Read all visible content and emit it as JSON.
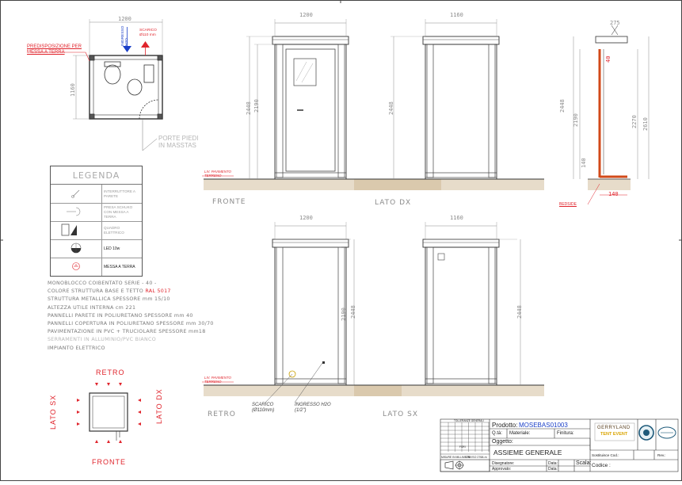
{
  "dims": {
    "plan_w": "1200",
    "plan_h": "1160",
    "fronte_w": "1200",
    "fronte_h1": "2448",
    "fronte_h2": "2190",
    "lato_dx_w": "1160",
    "lato_dx_h": "2448",
    "section_a": "2448",
    "section_b": "2190",
    "section_c": "2270",
    "section_d": "2610",
    "section_e": "140",
    "section_f": "140",
    "section_g": "40",
    "section_top": "275",
    "retro_w": "1200",
    "retro_h1": "2190",
    "retro_h2": "2448",
    "lato_sx_w": "1160",
    "lato_sx_h": "2448"
  },
  "plan_labels": {
    "predisposizione": "PREDISPOSIZIONE PER\nMESSA A TERRA",
    "ingresso": "INGRESSO\nH2O",
    "scarico": "SCARICO\nØ110 mm",
    "piedi": "PORTE PIEDI\nIN MASSTAS"
  },
  "view_labels": {
    "fronte": "FRONTE",
    "lato_dx": "LATO DX",
    "retro": "RETRO",
    "lato_sx": "LATO SX",
    "key_retro": "RETRO",
    "key_lato_sx": "LATO SX",
    "key_lato_dx": "LATO DX",
    "key_fronte": "FRONTE"
  },
  "ground_labels": {
    "fronte": "LIV. PAVIMENTO\nTERRENO",
    "retro": "LIV. PAVIMENTO\nTERRENO",
    "section": "BEDSIDE"
  },
  "retro_callouts": {
    "scarico": "SCARICO\n(Ø110mm)",
    "ingresso": "INGRESSO H2O\n(1/2\")"
  },
  "legend": {
    "title": "LEGENDA",
    "rows": [
      {
        "label": "INTERRUTTORE A PARETE",
        "symbol": "switch-icon",
        "dark": false
      },
      {
        "label": "PRESA SCHUKO CON MESSA A TERRA",
        "symbol": "socket-icon",
        "dark": false
      },
      {
        "label": "QUADRO ELETTRICO",
        "symbol": "panel-icon",
        "dark": false
      },
      {
        "label": "LED 10w",
        "symbol": "led-lamp-icon",
        "dark": true
      },
      {
        "label": "MESSA A TERRA",
        "symbol": "ground-icon",
        "dark": true
      }
    ],
    "panel_small": "QUADRO ELETTRICO"
  },
  "notes": [
    {
      "text": "MONOBLOCCO COIBENTATO SERIE - 40 -",
      "color": "#7a7a7a"
    },
    {
      "text": "COLORE STRUTTURA BASE E TETTO  RAL 5017",
      "color": "#7a7a7a",
      "accent": "RAL 5017"
    },
    {
      "text": "STRUTTURA METALLICA SPESSORE mm 15/10",
      "color": "#7a7a7a"
    },
    {
      "text": "ALTEZZA UTILE INTERNA cm 221",
      "color": "#7a7a7a"
    },
    {
      "text": "PANNELLI PARETE IN POLIURETANO SPESSORE mm 40",
      "color": "#7a7a7a"
    },
    {
      "text": "PANNELLI COPERTURA IN POLIURETANO SPESSORE mm 30/70",
      "color": "#7a7a7a"
    },
    {
      "text": "PAVIMENTAZIONE IN PVC + TRUCIOLARE SPESSORE mm18",
      "color": "#7a7a7a"
    },
    {
      "text": "SERRAMENTI IN ALLUMINIO/PVC BIANCO",
      "color": "#b8b8b8"
    },
    {
      "text": "IMPIANTO ELETTRICO",
      "color": "#7a7a7a"
    }
  ],
  "title_block": {
    "prodotto_label": "Prodotto:",
    "prodotto_value": "MOSEBAS01003",
    "qta_label": "Q.tà:",
    "materiale_label": "Materiale:",
    "finitura_label": "Finitura:",
    "oggetto_label": "Oggetto:",
    "oggetto_value": "ASSIEME GENERALE",
    "disegnatore_label": "Disegnatore:",
    "approvato_label": "Approvato:",
    "data1_label": "Data:",
    "data2_label": "Data:",
    "scala_label": "Scala:",
    "sostituisce_label": "Sostituisce Cod.:",
    "rev_label": "Rev.:",
    "codice_label": "Codice :",
    "brand_name": "GERRYLAND",
    "brand_sub": "TENT EVENT",
    "tolleranze_title": "TOLLERANZE GENERALI",
    "fori_title": "FORI",
    "note_row": "MISURE IN MILLIMETRI",
    "finish_code": "UNI ISO 2768-m"
  },
  "colors": {
    "line": "#3a3a3a",
    "dim": "#8a8a8a",
    "red": "#e0242c",
    "blue": "#1a3fc8",
    "ground": "#c9b18a",
    "section_red": "#d24a1a"
  }
}
